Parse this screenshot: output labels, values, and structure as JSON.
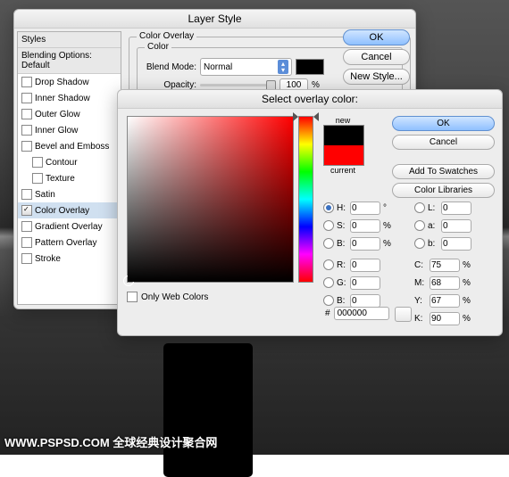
{
  "layerStyle": {
    "title": "Layer Style",
    "sidebar": {
      "stylesHeader": "Styles",
      "blendingHeader": "Blending Options: Default",
      "items": [
        {
          "label": "Drop Shadow",
          "checked": false
        },
        {
          "label": "Inner Shadow",
          "checked": false
        },
        {
          "label": "Outer Glow",
          "checked": false
        },
        {
          "label": "Inner Glow",
          "checked": false
        },
        {
          "label": "Bevel and Emboss",
          "checked": false
        },
        {
          "label": "Contour",
          "checked": false,
          "indent": true
        },
        {
          "label": "Texture",
          "checked": false,
          "indent": true
        },
        {
          "label": "Satin",
          "checked": false
        },
        {
          "label": "Color Overlay",
          "checked": true,
          "selected": true
        },
        {
          "label": "Gradient Overlay",
          "checked": false
        },
        {
          "label": "Pattern Overlay",
          "checked": false
        },
        {
          "label": "Stroke",
          "checked": false
        }
      ]
    },
    "colorOverlay": {
      "sectionTitle": "Color Overlay",
      "colorGroup": "Color",
      "blendModeLabel": "Blend Mode:",
      "blendMode": "Normal",
      "opacityLabel": "Opacity:",
      "opacity": "100",
      "opacityUnit": "%",
      "swatch": "#000000"
    },
    "buttons": {
      "ok": "OK",
      "cancel": "Cancel",
      "newStyle": "New Style..."
    }
  },
  "colorPicker": {
    "title": "Select overlay color:",
    "newLabel": "new",
    "currentLabel": "current",
    "colors": {
      "new": "#000000",
      "current": "#ff0000"
    },
    "buttons": {
      "ok": "OK",
      "cancel": "Cancel",
      "addSwatches": "Add To Swatches",
      "colorLibraries": "Color Libraries"
    },
    "onlyWebColors": {
      "label": "Only Web Colors",
      "checked": false
    },
    "hsb": {
      "h": "0",
      "hUnit": "°",
      "s": "0",
      "sUnit": "%",
      "b": "0",
      "bUnit": "%"
    },
    "lab": {
      "l": "0",
      "a": "0",
      "b": "0"
    },
    "rgb": {
      "r": "0",
      "g": "0",
      "b": "0"
    },
    "cmyk": {
      "c": "75",
      "cUnit": "%",
      "m": "68",
      "mUnit": "%",
      "y": "67",
      "yUnit": "%",
      "k": "90",
      "kUnit": "%"
    },
    "hexLabel": "#",
    "hex": "000000"
  },
  "watermark": "WWW.PSPSD.COM 全球经典设计聚合网"
}
